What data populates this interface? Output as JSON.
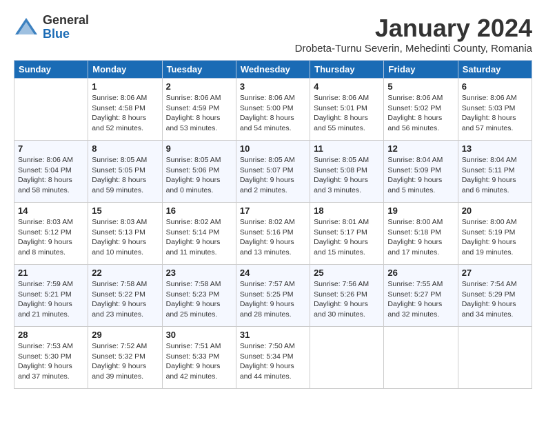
{
  "logo": {
    "general": "General",
    "blue": "Blue"
  },
  "title": {
    "month": "January 2024",
    "location": "Drobeta-Turnu Severin, Mehedinti County, Romania"
  },
  "weekdays": [
    "Sunday",
    "Monday",
    "Tuesday",
    "Wednesday",
    "Thursday",
    "Friday",
    "Saturday"
  ],
  "weeks": [
    [
      {
        "day": "",
        "info": ""
      },
      {
        "day": "1",
        "info": "Sunrise: 8:06 AM\nSunset: 4:58 PM\nDaylight: 8 hours\nand 52 minutes."
      },
      {
        "day": "2",
        "info": "Sunrise: 8:06 AM\nSunset: 4:59 PM\nDaylight: 8 hours\nand 53 minutes."
      },
      {
        "day": "3",
        "info": "Sunrise: 8:06 AM\nSunset: 5:00 PM\nDaylight: 8 hours\nand 54 minutes."
      },
      {
        "day": "4",
        "info": "Sunrise: 8:06 AM\nSunset: 5:01 PM\nDaylight: 8 hours\nand 55 minutes."
      },
      {
        "day": "5",
        "info": "Sunrise: 8:06 AM\nSunset: 5:02 PM\nDaylight: 8 hours\nand 56 minutes."
      },
      {
        "day": "6",
        "info": "Sunrise: 8:06 AM\nSunset: 5:03 PM\nDaylight: 8 hours\nand 57 minutes."
      }
    ],
    [
      {
        "day": "7",
        "info": "Sunrise: 8:06 AM\nSunset: 5:04 PM\nDaylight: 8 hours\nand 58 minutes."
      },
      {
        "day": "8",
        "info": "Sunrise: 8:05 AM\nSunset: 5:05 PM\nDaylight: 8 hours\nand 59 minutes."
      },
      {
        "day": "9",
        "info": "Sunrise: 8:05 AM\nSunset: 5:06 PM\nDaylight: 9 hours\nand 0 minutes."
      },
      {
        "day": "10",
        "info": "Sunrise: 8:05 AM\nSunset: 5:07 PM\nDaylight: 9 hours\nand 2 minutes."
      },
      {
        "day": "11",
        "info": "Sunrise: 8:05 AM\nSunset: 5:08 PM\nDaylight: 9 hours\nand 3 minutes."
      },
      {
        "day": "12",
        "info": "Sunrise: 8:04 AM\nSunset: 5:09 PM\nDaylight: 9 hours\nand 5 minutes."
      },
      {
        "day": "13",
        "info": "Sunrise: 8:04 AM\nSunset: 5:11 PM\nDaylight: 9 hours\nand 6 minutes."
      }
    ],
    [
      {
        "day": "14",
        "info": "Sunrise: 8:03 AM\nSunset: 5:12 PM\nDaylight: 9 hours\nand 8 minutes."
      },
      {
        "day": "15",
        "info": "Sunrise: 8:03 AM\nSunset: 5:13 PM\nDaylight: 9 hours\nand 10 minutes."
      },
      {
        "day": "16",
        "info": "Sunrise: 8:02 AM\nSunset: 5:14 PM\nDaylight: 9 hours\nand 11 minutes."
      },
      {
        "day": "17",
        "info": "Sunrise: 8:02 AM\nSunset: 5:16 PM\nDaylight: 9 hours\nand 13 minutes."
      },
      {
        "day": "18",
        "info": "Sunrise: 8:01 AM\nSunset: 5:17 PM\nDaylight: 9 hours\nand 15 minutes."
      },
      {
        "day": "19",
        "info": "Sunrise: 8:00 AM\nSunset: 5:18 PM\nDaylight: 9 hours\nand 17 minutes."
      },
      {
        "day": "20",
        "info": "Sunrise: 8:00 AM\nSunset: 5:19 PM\nDaylight: 9 hours\nand 19 minutes."
      }
    ],
    [
      {
        "day": "21",
        "info": "Sunrise: 7:59 AM\nSunset: 5:21 PM\nDaylight: 9 hours\nand 21 minutes."
      },
      {
        "day": "22",
        "info": "Sunrise: 7:58 AM\nSunset: 5:22 PM\nDaylight: 9 hours\nand 23 minutes."
      },
      {
        "day": "23",
        "info": "Sunrise: 7:58 AM\nSunset: 5:23 PM\nDaylight: 9 hours\nand 25 minutes."
      },
      {
        "day": "24",
        "info": "Sunrise: 7:57 AM\nSunset: 5:25 PM\nDaylight: 9 hours\nand 28 minutes."
      },
      {
        "day": "25",
        "info": "Sunrise: 7:56 AM\nSunset: 5:26 PM\nDaylight: 9 hours\nand 30 minutes."
      },
      {
        "day": "26",
        "info": "Sunrise: 7:55 AM\nSunset: 5:27 PM\nDaylight: 9 hours\nand 32 minutes."
      },
      {
        "day": "27",
        "info": "Sunrise: 7:54 AM\nSunset: 5:29 PM\nDaylight: 9 hours\nand 34 minutes."
      }
    ],
    [
      {
        "day": "28",
        "info": "Sunrise: 7:53 AM\nSunset: 5:30 PM\nDaylight: 9 hours\nand 37 minutes."
      },
      {
        "day": "29",
        "info": "Sunrise: 7:52 AM\nSunset: 5:32 PM\nDaylight: 9 hours\nand 39 minutes."
      },
      {
        "day": "30",
        "info": "Sunrise: 7:51 AM\nSunset: 5:33 PM\nDaylight: 9 hours\nand 42 minutes."
      },
      {
        "day": "31",
        "info": "Sunrise: 7:50 AM\nSunset: 5:34 PM\nDaylight: 9 hours\nand 44 minutes."
      },
      {
        "day": "",
        "info": ""
      },
      {
        "day": "",
        "info": ""
      },
      {
        "day": "",
        "info": ""
      }
    ]
  ]
}
